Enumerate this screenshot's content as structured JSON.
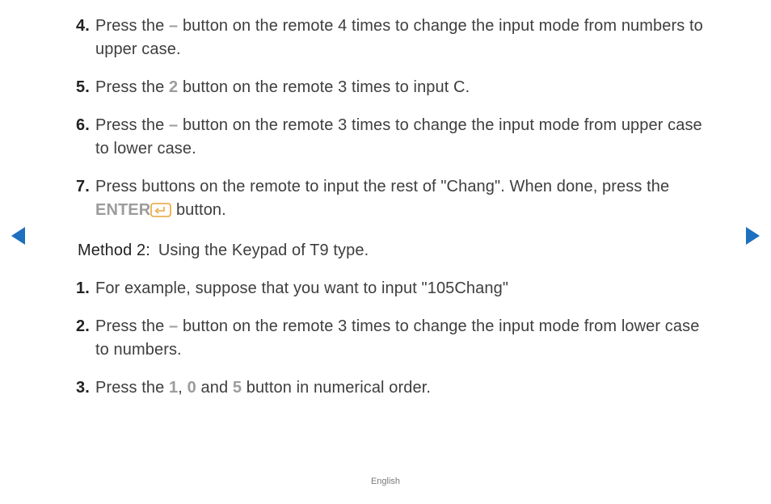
{
  "list1": [
    {
      "n": "4.",
      "pre": "Press the ",
      "key": "–",
      "post": " button on the remote 4 times to change the input mode from numbers to upper case."
    },
    {
      "n": "5.",
      "pre": "Press the ",
      "key": "2",
      "post": " button on the remote 3 times to input C."
    },
    {
      "n": "6.",
      "pre": "Press the ",
      "key": "–",
      "post": " button on the remote 3 times to change the input mode from upper case to lower case."
    },
    {
      "n": "7.",
      "pre": "Press buttons on the remote to input the rest of \"Chang\". When done, press the ",
      "key": "ENTER",
      "icon": true,
      "post": " button."
    }
  ],
  "method": {
    "label": "Method 2:",
    "body": "Using the Keypad of T9 type."
  },
  "list2": [
    {
      "n": "1.",
      "text": "For example, suppose that you want to input \"105Chang\""
    },
    {
      "n": "2.",
      "pre": "Press the ",
      "key": "–",
      "post": " button on the remote 3 times to change the input mode from lower case to numbers."
    },
    {
      "n": "3.",
      "pre": "Press the ",
      "k1": "1",
      "mid1": ", ",
      "k2": "0",
      "mid2": " and ",
      "k3": "5",
      "post": " button in numerical order."
    }
  ],
  "footer": "English"
}
